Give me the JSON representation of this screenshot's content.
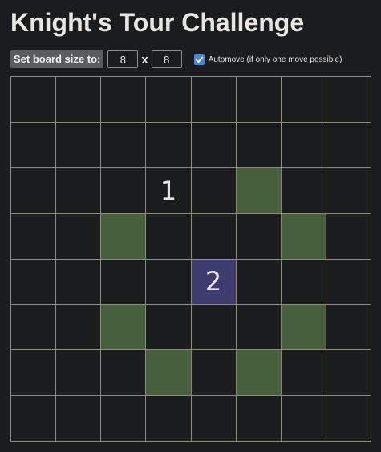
{
  "title": "Knight's Tour Challenge",
  "controls": {
    "set_size_label": "Set board size to:",
    "rows": "8",
    "times": "x",
    "cols": "8",
    "automove_checked": true,
    "automove_label": "Automove (if only one move possible)"
  },
  "colors": {
    "candidate": "#485f3d",
    "current": "#3e3c6e",
    "grid_line": "#8e8a7c"
  },
  "board": {
    "size": 8,
    "visited": [
      {
        "row": 2,
        "col": 3,
        "label": "1"
      },
      {
        "row": 4,
        "col": 4,
        "label": "2"
      }
    ],
    "current": {
      "row": 4,
      "col": 4
    },
    "candidates": [
      {
        "row": 2,
        "col": 5
      },
      {
        "row": 3,
        "col": 2
      },
      {
        "row": 3,
        "col": 6
      },
      {
        "row": 5,
        "col": 2
      },
      {
        "row": 5,
        "col": 6
      },
      {
        "row": 6,
        "col": 3
      },
      {
        "row": 6,
        "col": 5
      }
    ]
  }
}
